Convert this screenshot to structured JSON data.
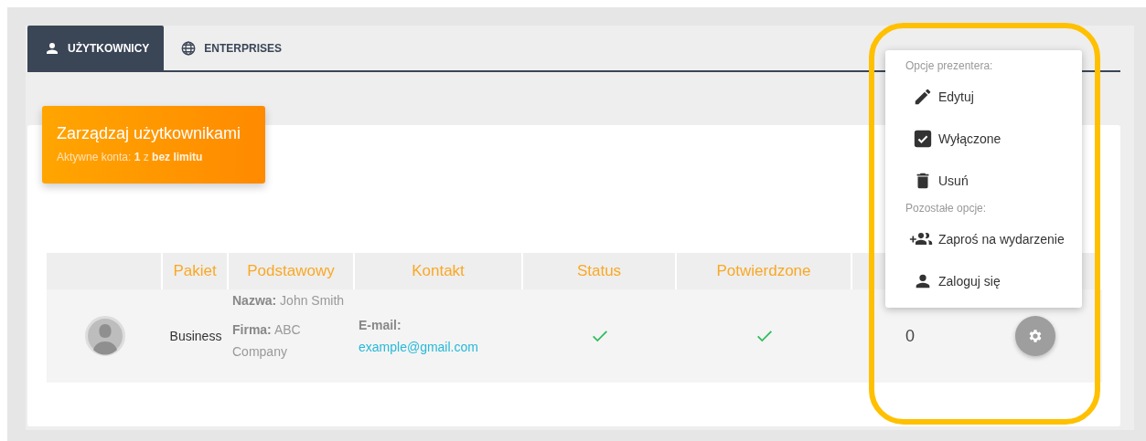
{
  "tabs": [
    {
      "label": "UŻYTKOWNICY",
      "kind": "person",
      "selected": true
    },
    {
      "label": "ENTERPRISES",
      "kind": "globe",
      "selected": false
    }
  ],
  "header_card": {
    "title": "Zarządzaj użytkownikami",
    "subtitle": "Aktywne konta: **1** z **bez limitu**"
  },
  "table": {
    "columns": [
      "Pakiet",
      "Podstawowy",
      "Kontakt",
      "Status",
      "Potwierdzone"
    ],
    "rows": [
      {
        "package": "Business",
        "name_label": "Nazwa:",
        "name": "John Smith",
        "company_label": "Firma:",
        "company": "ABC Company",
        "email_label": "E-mail:",
        "email": "example@gmail.com",
        "status": true,
        "confirmed": true,
        "column_7": "0"
      }
    ]
  },
  "menu": {
    "sections": [
      {
        "heading": "Opcje prezentera:",
        "items": [
          {
            "kind": "edit",
            "label": "Edytuj"
          },
          {
            "kind": "checkbox",
            "label": "Wyłączone",
            "checked": true
          },
          {
            "kind": "delete",
            "label": "Usuń"
          }
        ]
      },
      {
        "heading": "Pozostałe opcje:",
        "items": [
          {
            "kind": "invite",
            "label": "Zaproś na wydarzenie"
          },
          {
            "kind": "login",
            "label": "Zaloguj się"
          }
        ]
      }
    ]
  }
}
